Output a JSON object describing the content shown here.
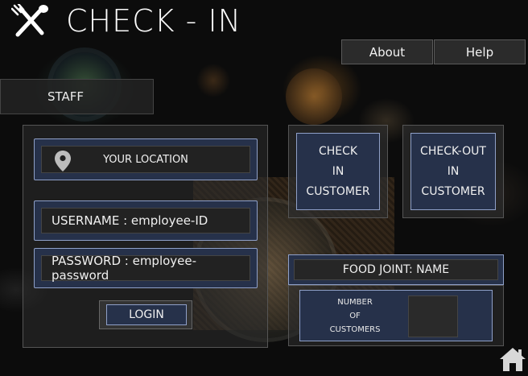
{
  "app": {
    "title": "CHECK - IN"
  },
  "header": {
    "about_label": "About",
    "help_label": "Help"
  },
  "staff": {
    "label": "STAFF"
  },
  "login_form": {
    "location_label": "YOUR LOCATION",
    "username_label": "USERNAME : employee-ID",
    "password_label": "PASSWORD : employee-password",
    "login_label": "LOGIN"
  },
  "actions": {
    "check_in": [
      "CHECK",
      "IN",
      "CUSTOMER"
    ],
    "check_out": [
      "CHECK-OUT",
      "IN",
      "CUSTOMER"
    ]
  },
  "food_joint": {
    "name_label": "FOOD JOINT: NAME",
    "count_label": [
      "NUMBER",
      "OF",
      "CUSTOMERS"
    ],
    "count_value": ""
  },
  "icons": {
    "logo": "fork-spoon-icon",
    "location": "map-pin-icon",
    "home": "home-icon"
  },
  "colors": {
    "accent": "#26314a",
    "accent_border": "#8fa0c8",
    "panel": "#2d2d2d"
  }
}
